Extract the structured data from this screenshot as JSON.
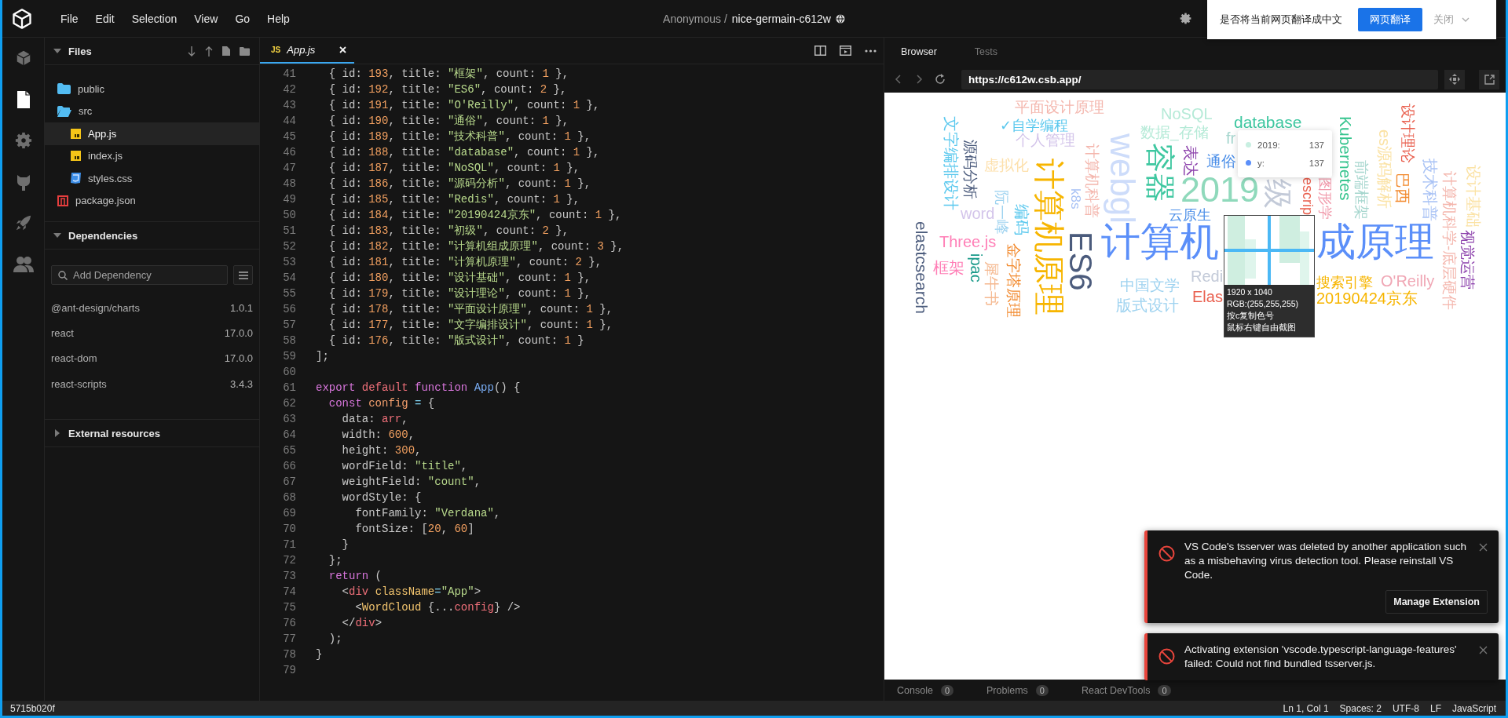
{
  "menu": [
    "File",
    "Edit",
    "Selection",
    "View",
    "Go",
    "Help"
  ],
  "title": {
    "owner": "Anonymous /",
    "sandbox": "nice-germain-c612w"
  },
  "translate_prompt": {
    "message": "是否将当前网页翻译成中文",
    "translate_button": "网页翻译",
    "close_label": "关闭"
  },
  "activity_bar": [
    {
      "kind": "box",
      "selected": false
    },
    {
      "kind": "file",
      "selected": true
    },
    {
      "kind": "gear",
      "selected": false
    },
    {
      "kind": "cat",
      "selected": false
    },
    {
      "kind": "rocket",
      "selected": false
    },
    {
      "kind": "people",
      "selected": false
    }
  ],
  "files": {
    "title": "Files",
    "expanded": true,
    "items": [
      {
        "name": "public",
        "kind": "folder",
        "expanded": false,
        "selected": false
      },
      {
        "name": "src",
        "kind": "folder",
        "expanded": true,
        "selected": false,
        "children": [
          {
            "name": "App.js",
            "kind": "js",
            "selected": true
          },
          {
            "name": "index.js",
            "kind": "js",
            "selected": false
          },
          {
            "name": "styles.css",
            "kind": "css",
            "selected": false
          }
        ]
      },
      {
        "name": "package.json",
        "kind": "json",
        "selected": false
      }
    ]
  },
  "dependencies": {
    "title": "Dependencies",
    "expanded": true,
    "placeholder": "Add Dependency",
    "items": [
      {
        "name": "@ant-design/charts",
        "version": "1.0.1"
      },
      {
        "name": "react",
        "version": "17.0.0"
      },
      {
        "name": "react-dom",
        "version": "17.0.0"
      },
      {
        "name": "react-scripts",
        "version": "3.4.3"
      }
    ]
  },
  "external_resources": {
    "title": "External resources",
    "expanded": false
  },
  "editor": {
    "tabs": [
      {
        "badge": "JS",
        "label": "App.js",
        "selected": true
      }
    ],
    "lines": [
      {
        "number": "41",
        "tokens": [
          {
            "text": "  { id: ",
            "kind": "plain"
          },
          {
            "text": "193",
            "kind": "number"
          },
          {
            "text": ", title: ",
            "kind": "plain"
          },
          {
            "text": "\"框架\"",
            "kind": "string"
          },
          {
            "text": ", count: ",
            "kind": "plain"
          },
          {
            "text": "1",
            "kind": "number"
          },
          {
            "text": " },",
            "kind": "plain"
          }
        ]
      },
      {
        "number": "42",
        "tokens": [
          {
            "text": "  { id: ",
            "kind": "plain"
          },
          {
            "text": "192",
            "kind": "number"
          },
          {
            "text": ", title: ",
            "kind": "plain"
          },
          {
            "text": "\"ES6\"",
            "kind": "string"
          },
          {
            "text": ", count: ",
            "kind": "plain"
          },
          {
            "text": "2",
            "kind": "number"
          },
          {
            "text": " },",
            "kind": "plain"
          }
        ]
      },
      {
        "number": "43",
        "tokens": [
          {
            "text": "  { id: ",
            "kind": "plain"
          },
          {
            "text": "191",
            "kind": "number"
          },
          {
            "text": ", title: ",
            "kind": "plain"
          },
          {
            "text": "\"O'Reilly\"",
            "kind": "string"
          },
          {
            "text": ", count: ",
            "kind": "plain"
          },
          {
            "text": "1",
            "kind": "number"
          },
          {
            "text": " },",
            "kind": "plain"
          }
        ]
      },
      {
        "number": "44",
        "tokens": [
          {
            "text": "  { id: ",
            "kind": "plain"
          },
          {
            "text": "190",
            "kind": "number"
          },
          {
            "text": ", title: ",
            "kind": "plain"
          },
          {
            "text": "\"通俗\"",
            "kind": "string"
          },
          {
            "text": ", count: ",
            "kind": "plain"
          },
          {
            "text": "1",
            "kind": "number"
          },
          {
            "text": " },",
            "kind": "plain"
          }
        ]
      },
      {
        "number": "45",
        "tokens": [
          {
            "text": "  { id: ",
            "kind": "plain"
          },
          {
            "text": "189",
            "kind": "number"
          },
          {
            "text": ", title: ",
            "kind": "plain"
          },
          {
            "text": "\"技术科普\"",
            "kind": "string"
          },
          {
            "text": ", count: ",
            "kind": "plain"
          },
          {
            "text": "1",
            "kind": "number"
          },
          {
            "text": " },",
            "kind": "plain"
          }
        ]
      },
      {
        "number": "46",
        "tokens": [
          {
            "text": "  { id: ",
            "kind": "plain"
          },
          {
            "text": "188",
            "kind": "number"
          },
          {
            "text": ", title: ",
            "kind": "plain"
          },
          {
            "text": "\"database\"",
            "kind": "string"
          },
          {
            "text": ", count: ",
            "kind": "plain"
          },
          {
            "text": "1",
            "kind": "number"
          },
          {
            "text": " },",
            "kind": "plain"
          }
        ]
      },
      {
        "number": "47",
        "tokens": [
          {
            "text": "  { id: ",
            "kind": "plain"
          },
          {
            "text": "187",
            "kind": "number"
          },
          {
            "text": ", title: ",
            "kind": "plain"
          },
          {
            "text": "\"NoSQL\"",
            "kind": "string"
          },
          {
            "text": ", count: ",
            "kind": "plain"
          },
          {
            "text": "1",
            "kind": "number"
          },
          {
            "text": " },",
            "kind": "plain"
          }
        ]
      },
      {
        "number": "48",
        "tokens": [
          {
            "text": "  { id: ",
            "kind": "plain"
          },
          {
            "text": "186",
            "kind": "number"
          },
          {
            "text": ", title: ",
            "kind": "plain"
          },
          {
            "text": "\"源码分析\"",
            "kind": "string"
          },
          {
            "text": ", count: ",
            "kind": "plain"
          },
          {
            "text": "1",
            "kind": "number"
          },
          {
            "text": " },",
            "kind": "plain"
          }
        ]
      },
      {
        "number": "49",
        "tokens": [
          {
            "text": "  { id: ",
            "kind": "plain"
          },
          {
            "text": "185",
            "kind": "number"
          },
          {
            "text": ", title: ",
            "kind": "plain"
          },
          {
            "text": "\"Redis\"",
            "kind": "string"
          },
          {
            "text": ", count: ",
            "kind": "plain"
          },
          {
            "text": "1",
            "kind": "number"
          },
          {
            "text": " },",
            "kind": "plain"
          }
        ]
      },
      {
        "number": "50",
        "tokens": [
          {
            "text": "  { id: ",
            "kind": "plain"
          },
          {
            "text": "184",
            "kind": "number"
          },
          {
            "text": ", title: ",
            "kind": "plain"
          },
          {
            "text": "\"20190424京东\"",
            "kind": "string"
          },
          {
            "text": ", count: ",
            "kind": "plain"
          },
          {
            "text": "1",
            "kind": "number"
          },
          {
            "text": " },",
            "kind": "plain"
          }
        ]
      },
      {
        "number": "51",
        "tokens": [
          {
            "text": "  { id: ",
            "kind": "plain"
          },
          {
            "text": "183",
            "kind": "number"
          },
          {
            "text": ", title: ",
            "kind": "plain"
          },
          {
            "text": "\"初级\"",
            "kind": "string"
          },
          {
            "text": ", count: ",
            "kind": "plain"
          },
          {
            "text": "2",
            "kind": "number"
          },
          {
            "text": " },",
            "kind": "plain"
          }
        ]
      },
      {
        "number": "52",
        "tokens": [
          {
            "text": "  { id: ",
            "kind": "plain"
          },
          {
            "text": "182",
            "kind": "number"
          },
          {
            "text": ", title: ",
            "kind": "plain"
          },
          {
            "text": "\"计算机组成原理\"",
            "kind": "string"
          },
          {
            "text": ", count: ",
            "kind": "plain"
          },
          {
            "text": "3",
            "kind": "number"
          },
          {
            "text": " },",
            "kind": "plain"
          }
        ]
      },
      {
        "number": "53",
        "tokens": [
          {
            "text": "  { id: ",
            "kind": "plain"
          },
          {
            "text": "181",
            "kind": "number"
          },
          {
            "text": ", title: ",
            "kind": "plain"
          },
          {
            "text": "\"计算机原理\"",
            "kind": "string"
          },
          {
            "text": ", count: ",
            "kind": "plain"
          },
          {
            "text": "2",
            "kind": "number"
          },
          {
            "text": " },",
            "kind": "plain"
          }
        ]
      },
      {
        "number": "54",
        "tokens": [
          {
            "text": "  { id: ",
            "kind": "plain"
          },
          {
            "text": "180",
            "kind": "number"
          },
          {
            "text": ", title: ",
            "kind": "plain"
          },
          {
            "text": "\"设计基础\"",
            "kind": "string"
          },
          {
            "text": ", count: ",
            "kind": "plain"
          },
          {
            "text": "1",
            "kind": "number"
          },
          {
            "text": " },",
            "kind": "plain"
          }
        ]
      },
      {
        "number": "55",
        "tokens": [
          {
            "text": "  { id: ",
            "kind": "plain"
          },
          {
            "text": "179",
            "kind": "number"
          },
          {
            "text": ", title: ",
            "kind": "plain"
          },
          {
            "text": "\"设计理论\"",
            "kind": "string"
          },
          {
            "text": ", count: ",
            "kind": "plain"
          },
          {
            "text": "1",
            "kind": "number"
          },
          {
            "text": " },",
            "kind": "plain"
          }
        ]
      },
      {
        "number": "56",
        "tokens": [
          {
            "text": "  { id: ",
            "kind": "plain"
          },
          {
            "text": "178",
            "kind": "number"
          },
          {
            "text": ", title: ",
            "kind": "plain"
          },
          {
            "text": "\"平面设计原理\"",
            "kind": "string"
          },
          {
            "text": ", count: ",
            "kind": "plain"
          },
          {
            "text": "1",
            "kind": "number"
          },
          {
            "text": " },",
            "kind": "plain"
          }
        ]
      },
      {
        "number": "57",
        "tokens": [
          {
            "text": "  { id: ",
            "kind": "plain"
          },
          {
            "text": "177",
            "kind": "number"
          },
          {
            "text": ", title: ",
            "kind": "plain"
          },
          {
            "text": "\"文字编排设计\"",
            "kind": "string"
          },
          {
            "text": ", count: ",
            "kind": "plain"
          },
          {
            "text": "1",
            "kind": "number"
          },
          {
            "text": " },",
            "kind": "plain"
          }
        ]
      },
      {
        "number": "58",
        "tokens": [
          {
            "text": "  { id: ",
            "kind": "plain"
          },
          {
            "text": "176",
            "kind": "number"
          },
          {
            "text": ", title: ",
            "kind": "plain"
          },
          {
            "text": "\"版式设计\"",
            "kind": "string"
          },
          {
            "text": ", count: ",
            "kind": "plain"
          },
          {
            "text": "1",
            "kind": "number"
          },
          {
            "text": " }",
            "kind": "plain"
          }
        ]
      },
      {
        "number": "59",
        "tokens": [
          {
            "text": "];",
            "kind": "plain"
          }
        ]
      },
      {
        "number": "60"
      },
      {
        "number": "61",
        "tokens": [
          {
            "text": "export ",
            "kind": "keyword"
          },
          {
            "text": "default ",
            "kind": "storage"
          },
          {
            "text": "function ",
            "kind": "keyword"
          },
          {
            "text": "App",
            "kind": "function"
          },
          {
            "text": "() {",
            "kind": "plain"
          }
        ]
      },
      {
        "number": "62",
        "tokens": [
          {
            "text": "  const ",
            "kind": "keyword"
          },
          {
            "text": "config ",
            "kind": "variable"
          },
          {
            "text": "=",
            "kind": "operator"
          },
          {
            "text": " {",
            "kind": "plain"
          }
        ]
      },
      {
        "number": "63",
        "tokens": [
          {
            "text": "    data: ",
            "kind": "plain"
          },
          {
            "text": "arr",
            "kind": "identifier"
          },
          {
            "text": ",",
            "kind": "plain"
          }
        ]
      },
      {
        "number": "64",
        "tokens": [
          {
            "text": "    width: ",
            "kind": "plain"
          },
          {
            "text": "600",
            "kind": "number"
          },
          {
            "text": ",",
            "kind": "plain"
          }
        ]
      },
      {
        "number": "65",
        "tokens": [
          {
            "text": "    height: ",
            "kind": "plain"
          },
          {
            "text": "300",
            "kind": "number"
          },
          {
            "text": ",",
            "kind": "plain"
          }
        ]
      },
      {
        "number": "66",
        "tokens": [
          {
            "text": "    wordField: ",
            "kind": "plain"
          },
          {
            "text": "\"title\"",
            "kind": "string"
          },
          {
            "text": ",",
            "kind": "plain"
          }
        ]
      },
      {
        "number": "67",
        "tokens": [
          {
            "text": "    weightField: ",
            "kind": "plain"
          },
          {
            "text": "\"count\"",
            "kind": "string"
          },
          {
            "text": ",",
            "kind": "plain"
          }
        ]
      },
      {
        "number": "68",
        "tokens": [
          {
            "text": "    wordStyle: {",
            "kind": "plain"
          }
        ]
      },
      {
        "number": "69",
        "tokens": [
          {
            "text": "      fontFamily: ",
            "kind": "plain"
          },
          {
            "text": "\"Verdana\"",
            "kind": "string"
          },
          {
            "text": ",",
            "kind": "plain"
          }
        ]
      },
      {
        "number": "70",
        "tokens": [
          {
            "text": "      fontSize: [",
            "kind": "plain"
          },
          {
            "text": "20",
            "kind": "number"
          },
          {
            "text": ", ",
            "kind": "plain"
          },
          {
            "text": "60",
            "kind": "number"
          },
          {
            "text": "]",
            "kind": "plain"
          }
        ]
      },
      {
        "number": "71",
        "tokens": [
          {
            "text": "    }",
            "kind": "plain"
          }
        ]
      },
      {
        "number": "72",
        "tokens": [
          {
            "text": "  };",
            "kind": "plain"
          }
        ]
      },
      {
        "number": "73",
        "tokens": [
          {
            "text": "  return",
            "kind": "keyword"
          },
          {
            "text": " (",
            "kind": "plain"
          }
        ]
      },
      {
        "number": "74",
        "tokens": [
          {
            "text": "    <",
            "kind": "plain"
          },
          {
            "text": "div ",
            "kind": "tag"
          },
          {
            "text": "className",
            "kind": "attribute"
          },
          {
            "text": "=",
            "kind": "operator"
          },
          {
            "text": "\"App\"",
            "kind": "string"
          },
          {
            "text": ">",
            "kind": "plain"
          }
        ]
      },
      {
        "number": "75",
        "tokens": [
          {
            "text": "      <",
            "kind": "plain"
          },
          {
            "text": "WordCloud",
            "kind": "attribute"
          },
          {
            "text": " {...",
            "kind": "plain"
          },
          {
            "text": "config",
            "kind": "identifier"
          },
          {
            "text": "} />",
            "kind": "plain"
          }
        ]
      },
      {
        "number": "76",
        "tokens": [
          {
            "text": "    </",
            "kind": "plain"
          },
          {
            "text": "div",
            "kind": "tag"
          },
          {
            "text": ">",
            "kind": "plain"
          }
        ]
      },
      {
        "number": "77",
        "tokens": [
          {
            "text": "  );",
            "kind": "plain"
          }
        ]
      },
      {
        "number": "78",
        "tokens": [
          {
            "text": "}",
            "kind": "plain"
          }
        ]
      },
      {
        "number": "79"
      }
    ]
  },
  "browser": {
    "tabs": [
      {
        "label": "Browser",
        "selected": true
      },
      {
        "label": "Tests",
        "selected": false
      }
    ],
    "url": "https://c612w.csb.app/",
    "word_cloud": {
      "words": [
        {
          "text": "平面设计原理",
          "color": "#f4b6ad"
        },
        {
          "text": "NoSQL",
          "color": "#b5ead7"
        },
        {
          "text": "✓自学编程",
          "color": "#5ac8ee"
        },
        {
          "text": "database",
          "color": "#3ec7a0"
        },
        {
          "text": "个人管理",
          "color": "#d3c4ea"
        },
        {
          "text": "数据_存储",
          "color": "#b5ead7"
        },
        {
          "text": "fr",
          "color": "#a6d6ce"
        },
        {
          "text": "设计理论",
          "color": "#e9604f"
        },
        {
          "text": "文字编排设计",
          "color": "#5ac8ee"
        },
        {
          "text": "虚拟化",
          "color": "#fde0ac"
        },
        {
          "text": "表达",
          "color": "#8e44ad"
        },
        {
          "text": "通俗",
          "color": "#4a8ee8"
        },
        {
          "text": "Kubernetes",
          "color": "#36c48e"
        },
        {
          "text": "源码分析",
          "color": "#4b5b7c"
        },
        {
          "text": "容器",
          "color": "#3ec7a0"
        },
        {
          "text": "es源码解析",
          "color": "#fbe2a4"
        },
        {
          "text": "计算机科普",
          "color": "#f4b6ad"
        },
        {
          "text": "webgl",
          "color": "#cddcfa"
        },
        {
          "text": "2019",
          "color": "#8fd9bb"
        },
        {
          "text": "前端框架",
          "color": "#a6d6ce"
        },
        {
          "text": "巴西",
          "color": "#f28a2e"
        },
        {
          "text": "技术科普",
          "color": "#a8c2f5"
        },
        {
          "text": "k8s",
          "color": "#a8c2f5"
        },
        {
          "text": "级",
          "color": "#c3cad8"
        },
        {
          "text": "escrip",
          "color": "#e9604f"
        },
        {
          "text": "图形学",
          "color": "#f19aab"
        },
        {
          "text": "设计基础",
          "color": "#fbe2a4"
        },
        {
          "text": "word",
          "color": "#d3c4ea"
        },
        {
          "text": "阮一峰",
          "color": "#9fd3f0"
        },
        {
          "text": "编码",
          "color": "#5ac8ee"
        },
        {
          "text": "云原生",
          "color": "#4a8ee8"
        },
        {
          "text": "Three.js",
          "color": "#ff7eb6"
        },
        {
          "text": "计算机原理",
          "color": "#f7b500"
        },
        {
          "text": "计算机",
          "color": "#5b8ff9"
        },
        {
          "text": "成原理",
          "color": "#5b8ff9"
        },
        {
          "text": "计算机科学-底层硬件",
          "color": "#f4b6ad"
        },
        {
          "text": "elastcsearch",
          "color": "#4b5b7c"
        },
        {
          "text": "框架",
          "color": "#ff7eb6"
        },
        {
          "text": "ipac",
          "color": "#1a9a8a"
        },
        {
          "text": "ES6",
          "color": "#4b5b7c"
        },
        {
          "text": "视觉运营",
          "color": "#8e44ad"
        },
        {
          "text": "犀牛书",
          "color": "#f5b88f"
        },
        {
          "text": "金字塔原理",
          "color": "#f28a2e"
        },
        {
          "text": "中国文学",
          "color": "#9fd3f0"
        },
        {
          "text": "Redi",
          "color": "#c3cad8"
        },
        {
          "text": "搜索引擎",
          "color": "#f7b500"
        },
        {
          "text": "O'Reilly",
          "color": "#f0a7b5"
        },
        {
          "text": "版式设计",
          "color": "#9fd3f0"
        },
        {
          "text": "Elas",
          "color": "#e9604f"
        },
        {
          "text": "20190424京东",
          "color": "#f7b500"
        }
      ]
    },
    "tooltip": {
      "rows": [
        {
          "label": "2019:",
          "value": "137",
          "color": "#c8efe1"
        },
        {
          "label": "y:",
          "value": "137",
          "color": "#5b8ff9"
        }
      ]
    },
    "screen_capture": {
      "size": "1920 x 1040",
      "rgb": "RGB:(255,255,255)",
      "hints": [
        "按c复制色号",
        "鼠标右键自由截图"
      ]
    },
    "panel_tabs": [
      {
        "label": "Console",
        "count": "0"
      },
      {
        "label": "Problems",
        "count": "0"
      },
      {
        "label": "React DevTools",
        "count": "0"
      }
    ]
  },
  "notifications": [
    {
      "message": "VS Code's tsserver was deleted by another application such as a misbehaving virus detection tool. Please reinstall VS Code.",
      "button": "Manage Extension"
    },
    {
      "message": "Activating extension 'vscode.typescript-language-features' failed: Could not find bundled tsserver.js."
    }
  ],
  "status_bar": {
    "left": "5715b020f",
    "right": [
      "Ln 1, Col 1",
      "Spaces: 2",
      "UTF-8",
      "LF",
      "JavaScript"
    ]
  }
}
